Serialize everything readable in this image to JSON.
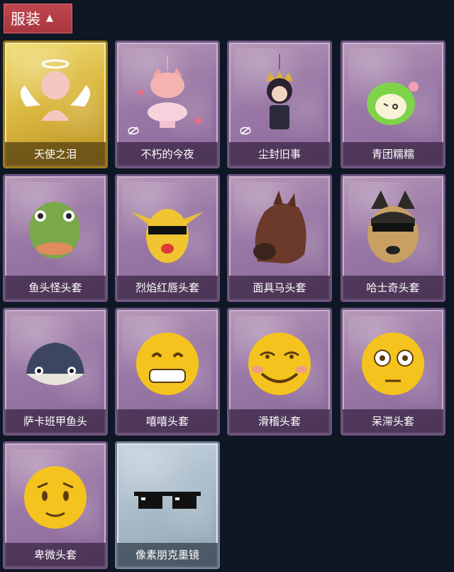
{
  "header": {
    "tab_label": "服装"
  },
  "items": [
    {
      "name": "天使之泪",
      "rarity": "gold",
      "hidden": false,
      "art": "angel-doll-icon"
    },
    {
      "name": "不朽的今夜",
      "rarity": "purple",
      "hidden": true,
      "art": "pink-fox-charm-icon"
    },
    {
      "name": "尘封旧事",
      "rarity": "purple",
      "hidden": true,
      "art": "crowned-doll-charm-icon"
    },
    {
      "name": "青团糯糯",
      "rarity": "purple",
      "hidden": false,
      "art": "green-mochi-icon"
    },
    {
      "name": "鱼头怪头套",
      "rarity": "purple",
      "hidden": false,
      "art": "fish-head-mask-icon"
    },
    {
      "name": "烈焰红唇头套",
      "rarity": "purple",
      "hidden": false,
      "art": "yellow-lips-mask-icon"
    },
    {
      "name": "面具马头套",
      "rarity": "purple",
      "hidden": false,
      "art": "horse-mask-icon"
    },
    {
      "name": "哈士奇头套",
      "rarity": "purple",
      "hidden": false,
      "art": "husky-mask-icon"
    },
    {
      "name": "萨卡班甲鱼头",
      "rarity": "purple",
      "hidden": false,
      "art": "sacabambaspis-head-icon"
    },
    {
      "name": "嘻嘻头套",
      "rarity": "purple",
      "hidden": false,
      "art": "grin-emoji-head-icon"
    },
    {
      "name": "滑稽头套",
      "rarity": "purple",
      "hidden": false,
      "art": "funny-emoji-head-icon"
    },
    {
      "name": "呆滞头套",
      "rarity": "purple",
      "hidden": false,
      "art": "dazed-emoji-head-icon"
    },
    {
      "name": "卑微头套",
      "rarity": "purple",
      "hidden": false,
      "art": "humble-emoji-head-icon"
    },
    {
      "name": "像素朋克墨镜",
      "rarity": "silver",
      "hidden": false,
      "art": "pixel-sunglasses-icon"
    }
  ],
  "colors": {
    "tab": "#b03c46",
    "background": "#0f1624",
    "purple": "#9a78a6",
    "gold": "#d9b63e",
    "silver": "#a8bac8"
  }
}
